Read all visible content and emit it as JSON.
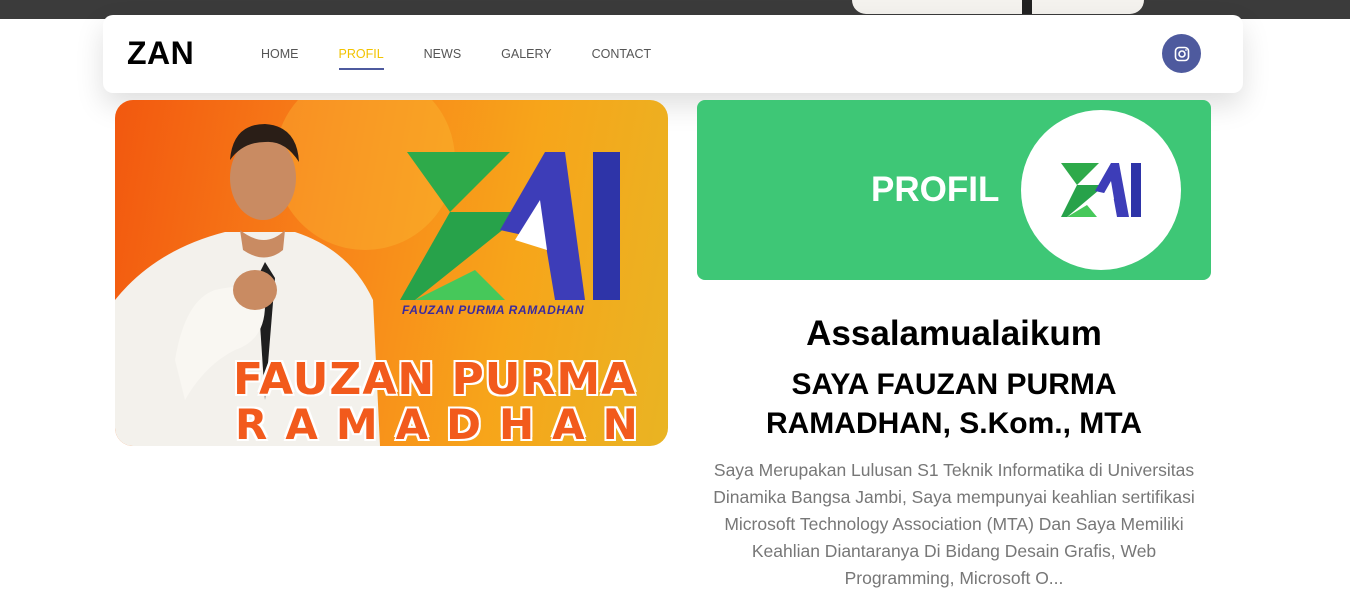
{
  "brand": "ZAN",
  "nav": {
    "home": "HOME",
    "profil": "PROFIL",
    "news": "NEWS",
    "galery": "GALERY",
    "contact": "CONTACT",
    "active": "PROFIL"
  },
  "social": {
    "icon": "instagram-icon"
  },
  "banner": {
    "name_line1": "FAUZAN PURMA",
    "name_line2": "RAMADHAN",
    "logo_caption": "FAUZAN PURMA RAMADHAN"
  },
  "profil_card": {
    "title": "PROFIL"
  },
  "about": {
    "greeting": "Assalamualaikum",
    "name": "SAYA FAUZAN PURMA RAMADHAN, S.Kom., MTA",
    "bio": "Saya Merupakan Lulusan S1 Teknik Informatika di Universitas Dinamika Bangsa Jambi, Saya mempunyai keahlian sertifikasi Microsoft Technology Association (MTA) Dan Saya Memiliki Keahlian Diantaranya Di Bidang Desain Grafis, Web Programming, Microsoft O..."
  },
  "colors": {
    "accent_green": "#3ec776",
    "nav_active": "#f2c300",
    "nav_underline": "#4e5a9e",
    "instagram_bg": "#4e5a9e"
  }
}
